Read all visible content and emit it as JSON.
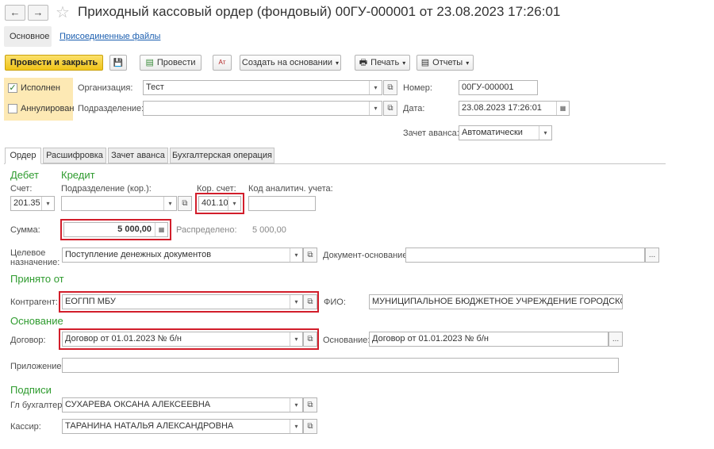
{
  "window": {
    "title": "Приходный кассовый ордер (фондовый) 00ГУ-000001 от 23.08.2023 17:26:01",
    "nav_back": "←",
    "nav_forward": "→",
    "star": "☆"
  },
  "top_tabs": {
    "main": "Основное",
    "files": "Присоединенные файлы"
  },
  "toolbar": {
    "post_close": "Провести и закрыть",
    "save": "💾",
    "post": "Провести",
    "ak": "Aт",
    "create_based": "Создать на основании",
    "print": "Печать",
    "reports": "Отчеты",
    "dropdown": "▾"
  },
  "status": {
    "executed_label": "Исполнен",
    "executed_check": "✓",
    "cancelled_label": "Аннулирован"
  },
  "header": {
    "org_label": "Организация:",
    "org_value": "Тест",
    "division_label": "Подразделение:",
    "division_value": "",
    "number_label": "Номер:",
    "number_value": "00ГУ-000001",
    "date_label": "Дата:",
    "date_value": "23.08.2023 17:26:01",
    "advance_label": "Зачет аванса:",
    "advance_value": "Автоматически"
  },
  "tabs": [
    "Ордер",
    "Расшифровка",
    "Зачет аванса",
    "Бухгалтерская операция"
  ],
  "order": {
    "debit_header": "Дебет",
    "credit_header": "Кредит",
    "account_label": "Счет:",
    "account_value": "201.35",
    "corr_division_label": "Подразделение (кор.):",
    "corr_division_value": "",
    "corr_account_label": "Кор. счет:",
    "corr_account_value": "401.10",
    "analytic_code_label": "Код аналитич. учета:",
    "analytic_code_value": "",
    "sum_label": "Сумма:",
    "sum_value": "5 000,00",
    "distributed_label": "Распределено:",
    "distributed_value": "5 000,00",
    "purpose_label_1": "Целевое",
    "purpose_label_2": "назначение:",
    "purpose_value": "Поступление денежных документов",
    "basis_doc_label": "Документ-основание:",
    "basis_doc_value": "",
    "received_header": "Принято от",
    "counterparty_label": "Контрагент:",
    "counterparty_value": "ЕОГПП МБУ",
    "fio_label": "ФИО:",
    "fio_value": "МУНИЦИПАЛЬНОЕ БЮДЖЕТНОЕ УЧРЕЖДЕНИЕ ГОРОДСКОГО ОКРУГА",
    "basis_header": "Основание",
    "contract_label": "Договор:",
    "contract_value": "Договор от 01.01.2023 № б/н",
    "basis_label": "Основание:",
    "basis_value": "Договор от 01.01.2023 № б/н",
    "attachment_label": "Приложение:",
    "attachment_value": "",
    "signatures_header": "Подписи",
    "chief_accountant_label": "Гл бухгалтер:",
    "chief_accountant_value": "СУХАРЕВА ОКСАНА АЛЕКСЕЕВНА",
    "cashier_label": "Кассир:",
    "cashier_value": "ТАРАНИНА НАТАЛЬЯ АЛЕКСАНДРОВНА"
  },
  "icons": {
    "dropdown": "▾",
    "open": "⧉",
    "ellipsis": "...",
    "calculator": "▦",
    "calendar": "▦"
  },
  "colors": {
    "accent_green": "#2e9b2e",
    "highlight_red": "#d21e2b",
    "primary_button": "#f5d130",
    "status_panel": "#fde9b4"
  }
}
